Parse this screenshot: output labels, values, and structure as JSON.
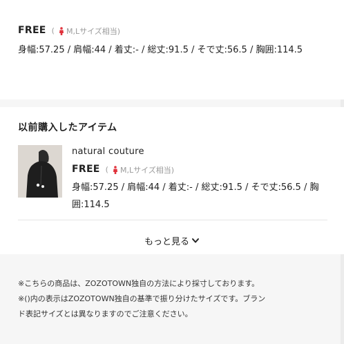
{
  "current_item": {
    "size_label": "FREE",
    "size_note_open": "(",
    "size_note_text": "M,Lサイズ相当)",
    "measurements": "身幅:57.25 / 肩幅:44 / 着丈:- / 総丈:91.5 / そで丈:56.5 / 胸囲:114.5"
  },
  "previous_purchase": {
    "section_title": "以前購入したアイテム",
    "brand": "natural couture",
    "size_label": "FREE",
    "size_note_open": "(",
    "size_note_text": "M,Lサイズ相当)",
    "measurements": "身幅:57.25 / 肩幅:44 / 着丈:- / 総丈:91.5 / そで丈:56.5 / 胸囲:114.5",
    "more_label": "もっと見る"
  },
  "footnotes": [
    "※こちらの商品は、ZOZOTOWN独自の方法により採寸しております。",
    "※()内の表示はZOZOTOWN独自の基準で振り分けたサイズです。ブラン",
    "ド表記サイズとは異なりますのでご注意ください。"
  ],
  "colors": {
    "accent_icon": "#e0323c",
    "text_primary": "#222222",
    "text_muted": "#9a9a9a",
    "background": "#f6f6f6"
  },
  "icons": {
    "person": "person-icon",
    "chevron": "chevron-down-icon"
  }
}
